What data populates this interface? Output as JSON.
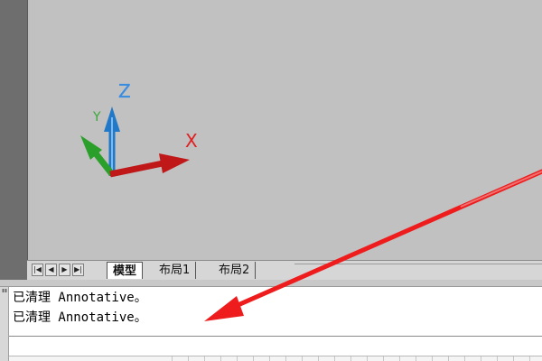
{
  "ucs": {
    "z_label": "Z",
    "y_label": "Y",
    "x_label": "X",
    "colors": {
      "z": "#1f78c8",
      "y": "#2aa02a",
      "x": "#c01818",
      "label_z": "#3a8de0",
      "label_y": "#3aa83a",
      "label_x": "#e02020"
    }
  },
  "tabs": {
    "nav_buttons": [
      "first-icon",
      "prev-icon",
      "next-icon",
      "last-icon"
    ],
    "items": [
      {
        "label": "模型",
        "active": true
      },
      {
        "label": "布局1",
        "active": false
      },
      {
        "label": "布局2",
        "active": false
      }
    ]
  },
  "command": {
    "history": [
      "已清理 Annotative。",
      "已清理 Annotative。"
    ],
    "prompt": ""
  },
  "annotation": {
    "arrow_color": "#ee1c1c"
  }
}
